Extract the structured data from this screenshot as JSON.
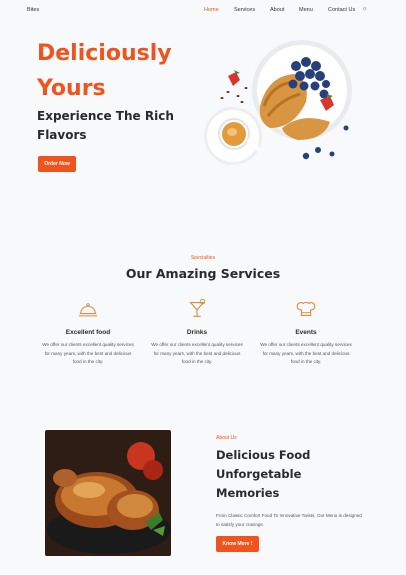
{
  "nav": {
    "brand": "Bites",
    "links": [
      "Home",
      "Services",
      "About",
      "Menu",
      "Contact Us"
    ],
    "active": "Home",
    "theme_icon": "sun-icon"
  },
  "hero": {
    "title_line1": "Deliciously",
    "title_line2": "Yours",
    "subtitle": "Experience The Rich Flavors",
    "cta": "Order Now"
  },
  "services": {
    "eyebrow": "Specialties",
    "title": "Our Amazing Services",
    "items": [
      {
        "icon": "cloche-icon",
        "name": "Excellent food",
        "desc": "We offer our clients excellent quality services for many years, with the best and delicious food in the city."
      },
      {
        "icon": "cocktail-icon",
        "name": "Drinks",
        "desc": "We offer our clients excellent quality services for many years, with the best and delicious food in the city."
      },
      {
        "icon": "chef-hat-icon",
        "name": "Events",
        "desc": "We offer our clients excellent quality services for many years, with the best and delicious food in the city."
      }
    ]
  },
  "about": {
    "eyebrow": "About Us",
    "title": "Delicious Food Unforgetable Memories",
    "text": "From Classic Comfort Food To Innovative Twists, Our Menu is designed to satisfy your cravings.",
    "cta": "Know More !"
  },
  "colors": {
    "accent": "#f0541e",
    "background": "#f8f9fb",
    "text": "#2a2a2a"
  }
}
